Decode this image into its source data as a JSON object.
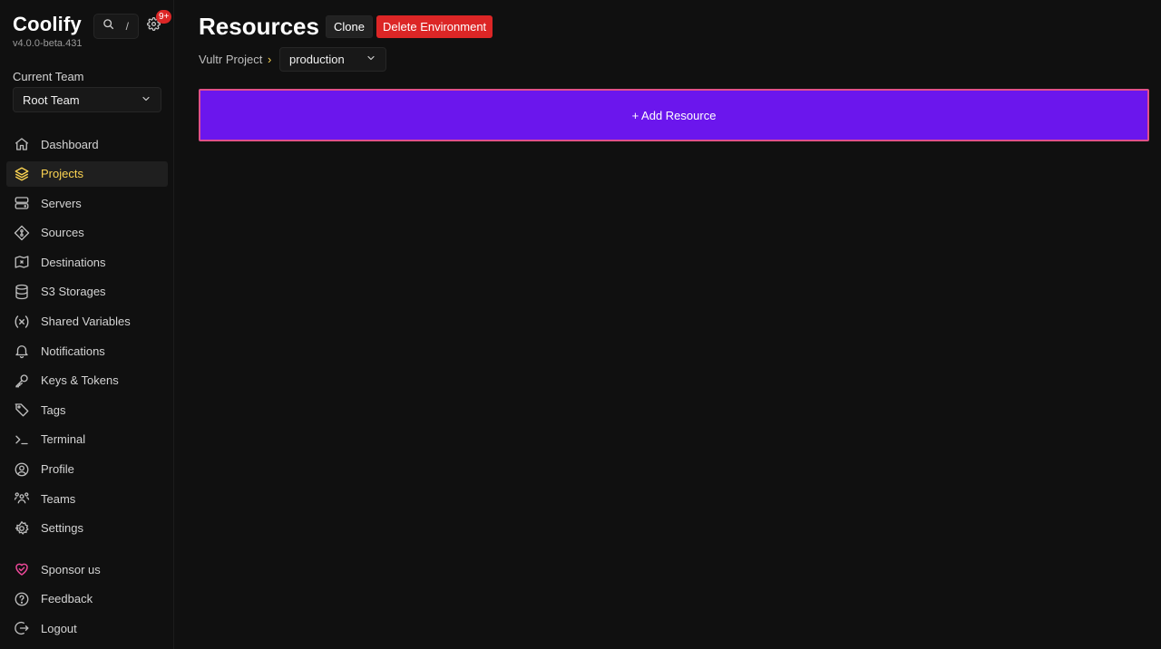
{
  "app": {
    "name": "Coolify",
    "version": "v4.0.0-beta.431",
    "search_shortcut": "/",
    "notification_badge": "9+"
  },
  "team": {
    "label": "Current Team",
    "selected": "Root Team"
  },
  "sidebar": {
    "items": [
      {
        "label": "Dashboard",
        "icon": "home-icon",
        "active": false
      },
      {
        "label": "Projects",
        "icon": "layers-icon",
        "active": true
      },
      {
        "label": "Servers",
        "icon": "server-icon",
        "active": false
      },
      {
        "label": "Sources",
        "icon": "git-icon",
        "active": false
      },
      {
        "label": "Destinations",
        "icon": "map-icon",
        "active": false
      },
      {
        "label": "S3 Storages",
        "icon": "database-icon",
        "active": false
      },
      {
        "label": "Shared Variables",
        "icon": "variable-icon",
        "active": false
      },
      {
        "label": "Notifications",
        "icon": "bell-icon",
        "active": false
      },
      {
        "label": "Keys & Tokens",
        "icon": "key-icon",
        "active": false
      },
      {
        "label": "Tags",
        "icon": "tag-icon",
        "active": false
      },
      {
        "label": "Terminal",
        "icon": "terminal-icon",
        "active": false
      },
      {
        "label": "Profile",
        "icon": "user-circle-icon",
        "active": false
      },
      {
        "label": "Teams",
        "icon": "users-icon",
        "active": false
      },
      {
        "label": "Settings",
        "icon": "gear-icon",
        "active": false
      }
    ],
    "bottom_items": [
      {
        "label": "Sponsor us",
        "icon": "heart-icon"
      },
      {
        "label": "Feedback",
        "icon": "help-circle-icon"
      },
      {
        "label": "Logout",
        "icon": "logout-icon"
      }
    ]
  },
  "header": {
    "title": "Resources",
    "clone_label": "Clone",
    "delete_label": "Delete Environment"
  },
  "breadcrumb": {
    "project": "Vultr Project",
    "separator": "›",
    "environment": "production"
  },
  "main": {
    "add_resource_label": "+ Add Resource"
  },
  "colors": {
    "accent_yellow": "#fcd452",
    "add_resource_bg": "#6b16ed",
    "add_resource_border": "#e0508a",
    "danger": "#dc2626",
    "sponsor_pink": "#ec4899"
  }
}
